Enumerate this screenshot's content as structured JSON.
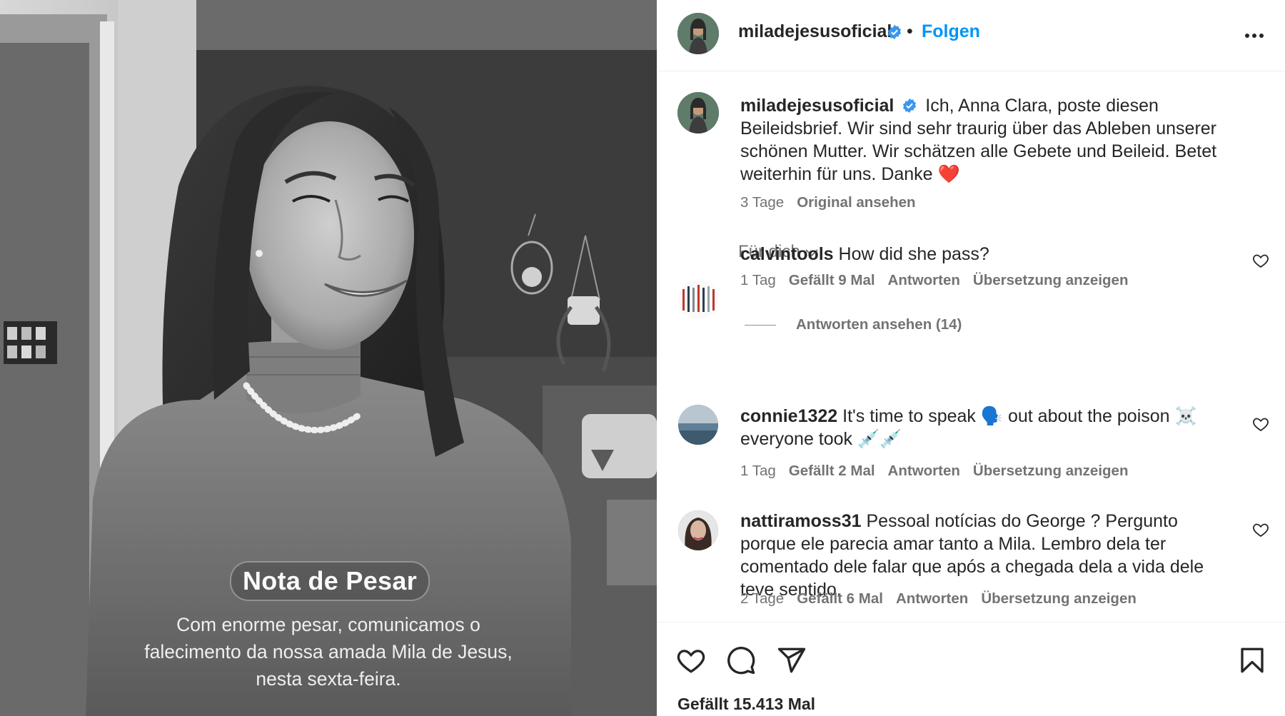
{
  "post": {
    "username": "miladejesusoficial",
    "follow_label": "Folgen",
    "separator": "•",
    "more_label": "..."
  },
  "image_overlay": {
    "title": "Nota de Pesar",
    "lines": [
      "Com enorme pesar, comunicamos o",
      "falecimento da nossa amada Mila de Jesus,",
      "nesta sexta-feira."
    ]
  },
  "caption": {
    "username": "miladejesusoficial",
    "text": "Ich, Anna Clara, poste diesen Beileidsbrief. Wir sind sehr traurig über das Ableben unserer schönen Mutter. Wir schätzen alle Gebete und Beileid. Betet weiterhin für uns. Danke",
    "emoji": "❤️",
    "age": "3 Tage",
    "see_original": "Original ansehen"
  },
  "for_you": "Für dich",
  "comments": [
    {
      "username": "calvintools",
      "text": "How did she pass?",
      "age": "1 Tag",
      "likes": "Gefällt 9 Mal",
      "reply": "Antworten",
      "translate": "Übersetzung anzeigen",
      "view_replies": "Antworten ansehen (14)"
    },
    {
      "username": "connie1322",
      "text_a": "It's time to speak",
      "emoji_a": "🗣️",
      "text_b": "out about the poison",
      "emoji_b": "☠️",
      "text_c": "everyone took",
      "emoji_c": "💉💉",
      "age": "1 Tag",
      "likes": "Gefällt 2 Mal",
      "reply": "Antworten",
      "translate": "Übersetzung anzeigen"
    },
    {
      "username": "nattiramoss31",
      "text": "Pessoal notícias do George ? Pergunto porque ele parecia amar tanto a Mila. Lembro dela ter comentado dele falar que após a chegada dela a vida dele teve sentido.",
      "age": "2 Tage",
      "likes": "Gefällt 6 Mal",
      "reply": "Antworten",
      "translate": "Übersetzung anzeigen"
    }
  ],
  "likes_total": "Gefällt 15.413 Mal",
  "icons": {
    "verified": "verified-badge-icon",
    "like": "heart-icon",
    "comment": "comment-bubble-icon",
    "share": "paper-plane-icon",
    "save": "bookmark-icon",
    "more": "more-dots-icon",
    "chevron": "chevron-down-icon"
  },
  "colors": {
    "follow": "#0095f6",
    "verified": "#3897f0",
    "text": "#262626",
    "muted": "#737373",
    "emoji_heart": "#e0245e"
  }
}
